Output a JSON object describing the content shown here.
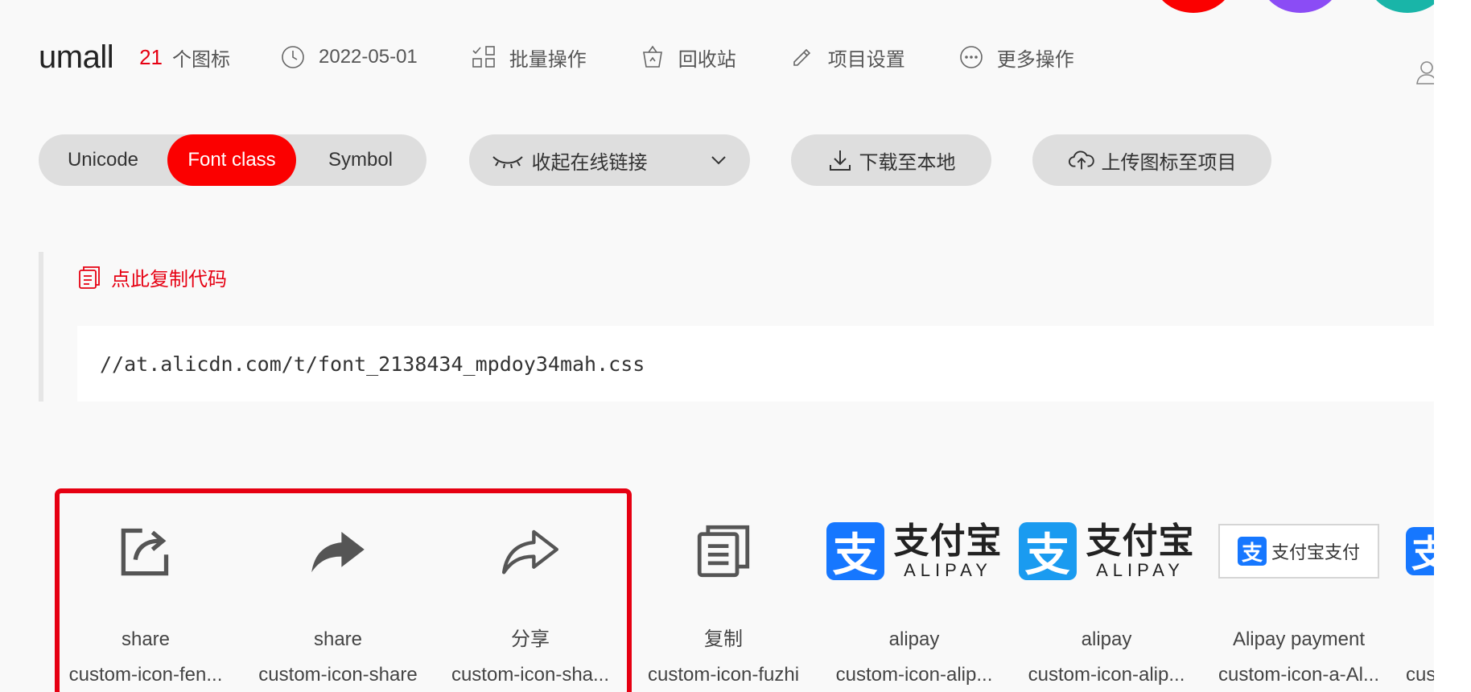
{
  "colors": {
    "accent": "#e60012",
    "active_segment": "#fb0000",
    "avatar_1": "#fb0000",
    "avatar_2": "#8b4cf5",
    "avatar_3": "#19b5a8",
    "alipay_blue": "#1677ff"
  },
  "header": {
    "project_name": "umall",
    "icon_count": "21",
    "icon_count_label": "个图标",
    "date": "2022-05-01",
    "batch_label": "批量操作",
    "recycle_label": "回收站",
    "settings_label": "项目设置",
    "more_label": "更多操作"
  },
  "toolbar": {
    "tabs": [
      {
        "label": "Unicode",
        "active": false
      },
      {
        "label": "Font class",
        "active": true
      },
      {
        "label": "Symbol",
        "active": false
      }
    ],
    "collapse_link_label": "收起在线链接",
    "download_label": "下载至本地",
    "upload_label": "上传图标至项目"
  },
  "code": {
    "copy_label": "点此复制代码",
    "url": "//at.alicdn.com/t/font_2138434_mpdoy34mah.css"
  },
  "icons": [
    {
      "name": "share",
      "class": "custom-icon-fen...",
      "icon": "share-box-icon",
      "selected": true
    },
    {
      "name": "share",
      "class": "custom-icon-share",
      "icon": "share-arrow-filled-icon",
      "selected": true
    },
    {
      "name": "分享",
      "class": "custom-icon-sha...",
      "icon": "share-arrow-outline-icon",
      "selected": true
    },
    {
      "name": "复制",
      "class": "custom-icon-fuzhi",
      "icon": "copy-document-icon",
      "selected": false
    },
    {
      "name": "alipay",
      "class": "custom-icon-alip...",
      "icon": "alipay-logo-icon",
      "selected": false
    },
    {
      "name": "alipay",
      "class": "custom-icon-alip...",
      "icon": "alipay-logo-light-icon",
      "selected": false
    },
    {
      "name": "Alipay payment",
      "class": "custom-icon-a-Al...",
      "icon": "alipay-payment-icon",
      "selected": false
    },
    {
      "name": "",
      "class": "cust",
      "icon": "alipay-partial-icon",
      "selected": false
    }
  ],
  "alipay": {
    "mark": "支",
    "cn": "支付宝",
    "en": "ALIPAY",
    "payment_text": "支付宝支付"
  }
}
